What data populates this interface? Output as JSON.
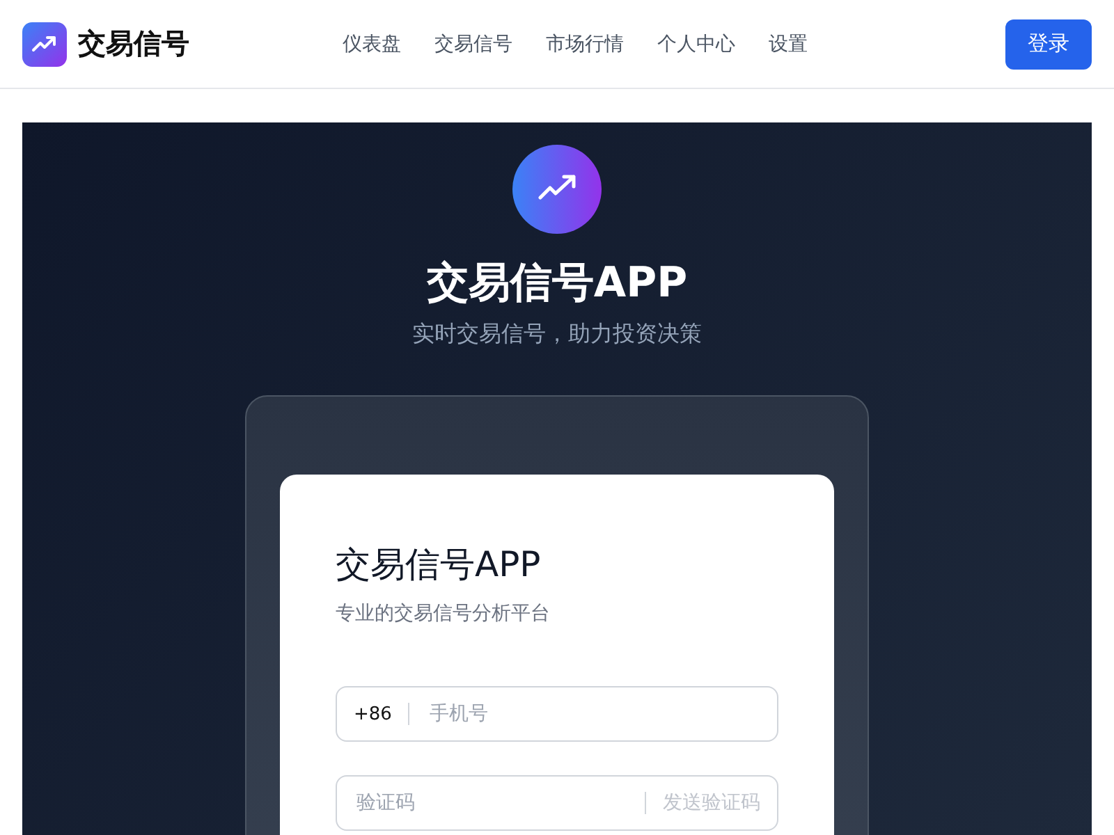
{
  "header": {
    "brand": "交易信号",
    "nav": [
      {
        "label": "仪表盘",
        "selected": false
      },
      {
        "label": "交易信号",
        "selected": false
      },
      {
        "label": "市场行情",
        "selected": false
      },
      {
        "label": "个人中心",
        "selected": false
      },
      {
        "label": "设置",
        "selected": false
      }
    ],
    "login_button": "登录"
  },
  "hero": {
    "title": "交易信号APP",
    "subtitle": "实时交易信号，助力投资决策"
  },
  "login_card": {
    "title": "交易信号APP",
    "subtitle": "专业的交易信号分析平台",
    "phone_field": {
      "prefix": "+86",
      "placeholder": "手机号"
    },
    "code_field": {
      "placeholder": "验证码",
      "send_button": {
        "label": "发送验证码",
        "disabled": true
      }
    }
  }
}
